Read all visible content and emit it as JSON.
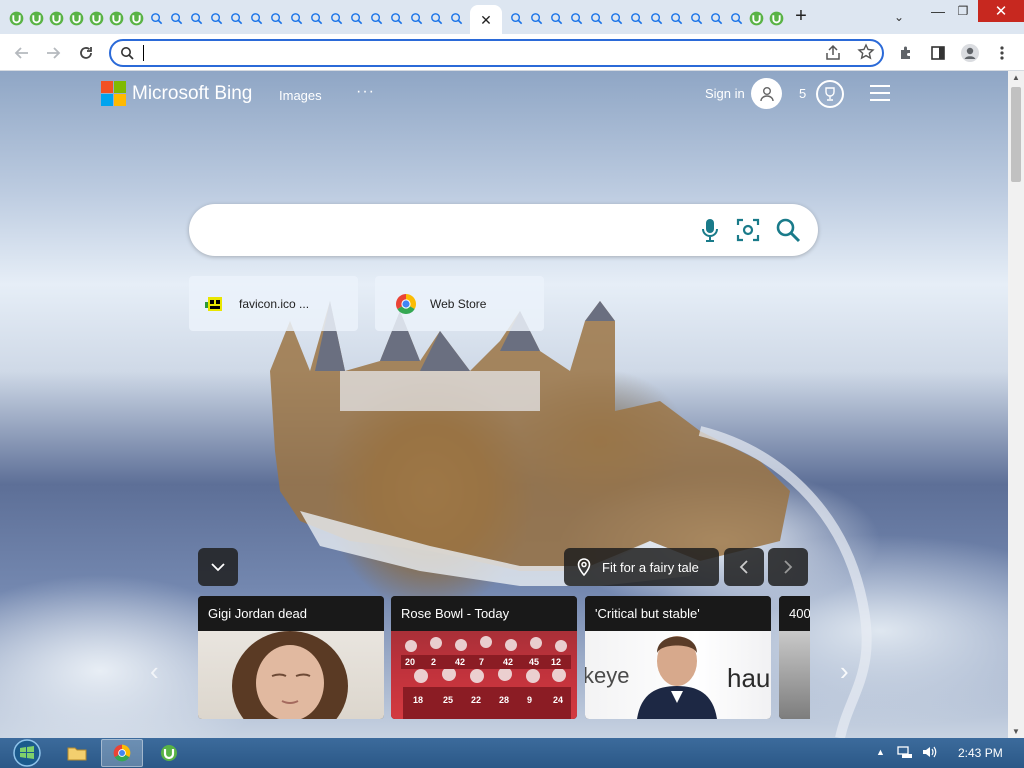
{
  "browser": {
    "tabs_before_active": [
      "utorrent",
      "utorrent",
      "utorrent",
      "utorrent",
      "utorrent",
      "utorrent",
      "utorrent",
      "search",
      "search",
      "search",
      "search",
      "search",
      "search",
      "search",
      "search",
      "search",
      "search",
      "search",
      "search",
      "search",
      "search",
      "search",
      "search"
    ],
    "active_tab_close": "✕",
    "tabs_after_active": [
      "search",
      "search",
      "search",
      "search",
      "search",
      "search",
      "search",
      "search",
      "search",
      "search",
      "search",
      "search",
      "utorrent",
      "utorrent"
    ],
    "new_tab_glyph": "+",
    "window_controls": {
      "tab_menu": "⌄",
      "minimize": "—",
      "maximize": "❐",
      "close": "✕"
    },
    "omnibox": {
      "value": "",
      "placeholder": ""
    }
  },
  "bing": {
    "brand": "Microsoft Bing",
    "nav": {
      "images": "Images",
      "more": "···"
    },
    "sign_in": "Sign in",
    "points": "5",
    "search_placeholder": "",
    "logo_colors": [
      "#f25022",
      "#7fba00",
      "#00a4ef",
      "#ffb900"
    ],
    "accent_color": "#1a7b8a"
  },
  "quick_links": [
    {
      "label": "favicon.ico ...",
      "icon": "favicon-icon"
    },
    {
      "label": "Web Store",
      "icon": "chrome-icon"
    }
  ],
  "carousel": {
    "collapse_glyph": "⌄",
    "image_caption": "Fit for a fairy tale",
    "prev_glyph": "‹",
    "next_glyph": "›",
    "cards": [
      {
        "title": "Gigi Jordan dead"
      },
      {
        "title": "Rose Bowl - Today"
      },
      {
        "title": "'Critical but stable'"
      },
      {
        "title": "400"
      }
    ],
    "side_prev": "‹",
    "side_next": "›"
  },
  "taskbar": {
    "apps": [
      "file-explorer",
      "chrome",
      "utorrent"
    ],
    "clock": "2:43 PM"
  }
}
